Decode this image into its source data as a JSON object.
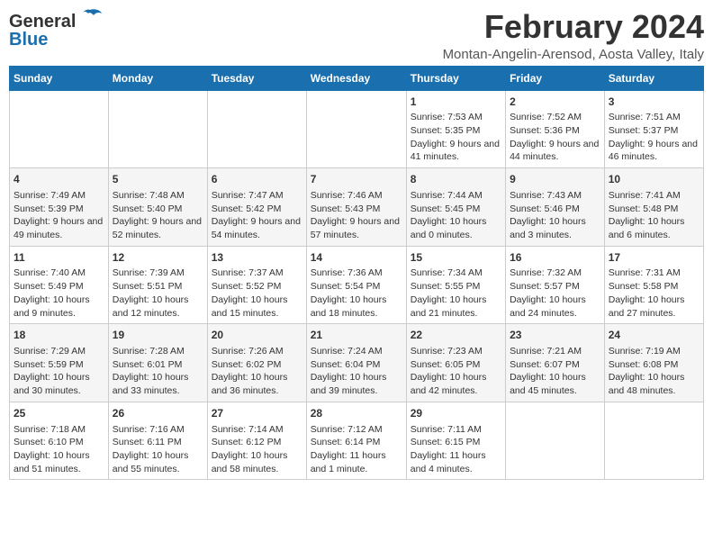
{
  "header": {
    "logo_general": "General",
    "logo_blue": "Blue",
    "month_title": "February 2024",
    "location": "Montan-Angelin-Arensod, Aosta Valley, Italy"
  },
  "days_of_week": [
    "Sunday",
    "Monday",
    "Tuesday",
    "Wednesday",
    "Thursday",
    "Friday",
    "Saturday"
  ],
  "weeks": [
    [
      {
        "day": "",
        "content": ""
      },
      {
        "day": "",
        "content": ""
      },
      {
        "day": "",
        "content": ""
      },
      {
        "day": "",
        "content": ""
      },
      {
        "day": "1",
        "content": "Sunrise: 7:53 AM\nSunset: 5:35 PM\nDaylight: 9 hours and 41 minutes."
      },
      {
        "day": "2",
        "content": "Sunrise: 7:52 AM\nSunset: 5:36 PM\nDaylight: 9 hours and 44 minutes."
      },
      {
        "day": "3",
        "content": "Sunrise: 7:51 AM\nSunset: 5:37 PM\nDaylight: 9 hours and 46 minutes."
      }
    ],
    [
      {
        "day": "4",
        "content": "Sunrise: 7:49 AM\nSunset: 5:39 PM\nDaylight: 9 hours and 49 minutes."
      },
      {
        "day": "5",
        "content": "Sunrise: 7:48 AM\nSunset: 5:40 PM\nDaylight: 9 hours and 52 minutes."
      },
      {
        "day": "6",
        "content": "Sunrise: 7:47 AM\nSunset: 5:42 PM\nDaylight: 9 hours and 54 minutes."
      },
      {
        "day": "7",
        "content": "Sunrise: 7:46 AM\nSunset: 5:43 PM\nDaylight: 9 hours and 57 minutes."
      },
      {
        "day": "8",
        "content": "Sunrise: 7:44 AM\nSunset: 5:45 PM\nDaylight: 10 hours and 0 minutes."
      },
      {
        "day": "9",
        "content": "Sunrise: 7:43 AM\nSunset: 5:46 PM\nDaylight: 10 hours and 3 minutes."
      },
      {
        "day": "10",
        "content": "Sunrise: 7:41 AM\nSunset: 5:48 PM\nDaylight: 10 hours and 6 minutes."
      }
    ],
    [
      {
        "day": "11",
        "content": "Sunrise: 7:40 AM\nSunset: 5:49 PM\nDaylight: 10 hours and 9 minutes."
      },
      {
        "day": "12",
        "content": "Sunrise: 7:39 AM\nSunset: 5:51 PM\nDaylight: 10 hours and 12 minutes."
      },
      {
        "day": "13",
        "content": "Sunrise: 7:37 AM\nSunset: 5:52 PM\nDaylight: 10 hours and 15 minutes."
      },
      {
        "day": "14",
        "content": "Sunrise: 7:36 AM\nSunset: 5:54 PM\nDaylight: 10 hours and 18 minutes."
      },
      {
        "day": "15",
        "content": "Sunrise: 7:34 AM\nSunset: 5:55 PM\nDaylight: 10 hours and 21 minutes."
      },
      {
        "day": "16",
        "content": "Sunrise: 7:32 AM\nSunset: 5:57 PM\nDaylight: 10 hours and 24 minutes."
      },
      {
        "day": "17",
        "content": "Sunrise: 7:31 AM\nSunset: 5:58 PM\nDaylight: 10 hours and 27 minutes."
      }
    ],
    [
      {
        "day": "18",
        "content": "Sunrise: 7:29 AM\nSunset: 5:59 PM\nDaylight: 10 hours and 30 minutes."
      },
      {
        "day": "19",
        "content": "Sunrise: 7:28 AM\nSunset: 6:01 PM\nDaylight: 10 hours and 33 minutes."
      },
      {
        "day": "20",
        "content": "Sunrise: 7:26 AM\nSunset: 6:02 PM\nDaylight: 10 hours and 36 minutes."
      },
      {
        "day": "21",
        "content": "Sunrise: 7:24 AM\nSunset: 6:04 PM\nDaylight: 10 hours and 39 minutes."
      },
      {
        "day": "22",
        "content": "Sunrise: 7:23 AM\nSunset: 6:05 PM\nDaylight: 10 hours and 42 minutes."
      },
      {
        "day": "23",
        "content": "Sunrise: 7:21 AM\nSunset: 6:07 PM\nDaylight: 10 hours and 45 minutes."
      },
      {
        "day": "24",
        "content": "Sunrise: 7:19 AM\nSunset: 6:08 PM\nDaylight: 10 hours and 48 minutes."
      }
    ],
    [
      {
        "day": "25",
        "content": "Sunrise: 7:18 AM\nSunset: 6:10 PM\nDaylight: 10 hours and 51 minutes."
      },
      {
        "day": "26",
        "content": "Sunrise: 7:16 AM\nSunset: 6:11 PM\nDaylight: 10 hours and 55 minutes."
      },
      {
        "day": "27",
        "content": "Sunrise: 7:14 AM\nSunset: 6:12 PM\nDaylight: 10 hours and 58 minutes."
      },
      {
        "day": "28",
        "content": "Sunrise: 7:12 AM\nSunset: 6:14 PM\nDaylight: 11 hours and 1 minute."
      },
      {
        "day": "29",
        "content": "Sunrise: 7:11 AM\nSunset: 6:15 PM\nDaylight: 11 hours and 4 minutes."
      },
      {
        "day": "",
        "content": ""
      },
      {
        "day": "",
        "content": ""
      }
    ]
  ]
}
